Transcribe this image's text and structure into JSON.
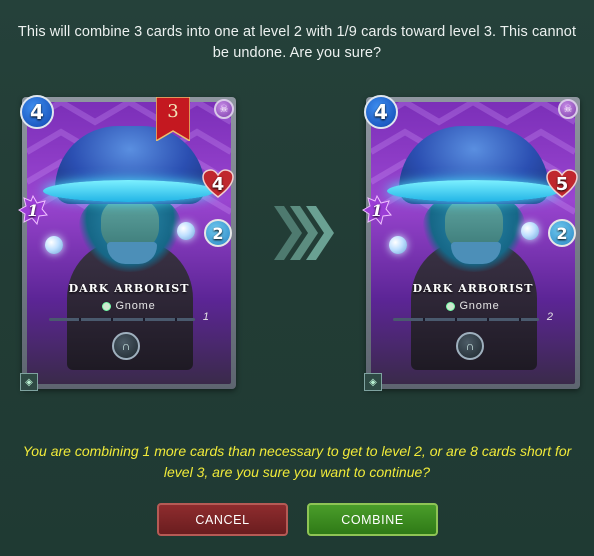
{
  "dialog": {
    "confirm_message": "This will combine 3 cards into one at level 2 with 1/9 cards toward level 3. This cannot be undone. Are you sure?",
    "warning_message": "You are combining 1 more cards than necessary to get to level 2, or are 8 cards short for level 3, are you sure you want to continue?"
  },
  "cards": {
    "before": {
      "name": "DARK ARBORIST",
      "type": "Gnome",
      "mana": "4",
      "health": "4",
      "armor": "2",
      "magic": "1",
      "level": "1",
      "combine_count": "3",
      "element": "death",
      "ability_icon": "ability-icon"
    },
    "after": {
      "name": "DARK ARBORIST",
      "type": "Gnome",
      "mana": "4",
      "health": "5",
      "armor": "2",
      "magic": "1",
      "level": "2",
      "element": "death",
      "ability_icon": "ability-icon"
    }
  },
  "buttons": {
    "cancel_label": "CANCEL",
    "combine_label": "COMBINE"
  },
  "colors": {
    "background": "#223c35",
    "warning": "#f0ea3a",
    "cancel": "#7a2426",
    "combine": "#3e8c20",
    "health_heart": "#c0272d",
    "mana": "#1d5cc4",
    "ribbon": "#c41820"
  }
}
